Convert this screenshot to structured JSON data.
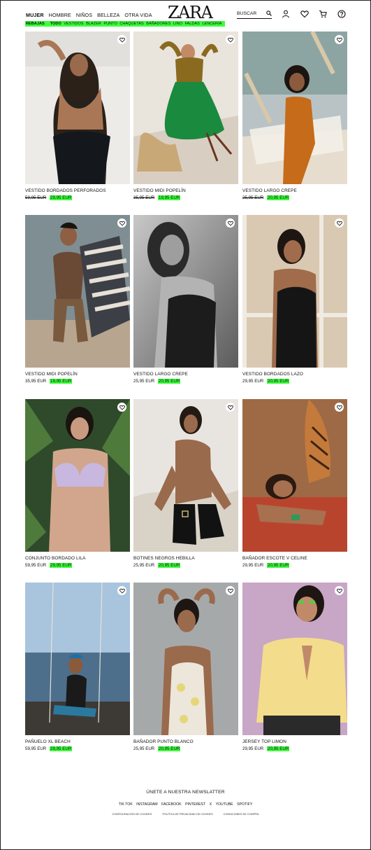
{
  "header": {
    "nav": [
      "MUJER",
      "HOMBRE",
      "NIÑOS",
      "BELLEZA",
      "OTRA VIDA"
    ],
    "active_nav": "MUJER",
    "logo": "ZARA",
    "search_placeholder": "BUSCAR",
    "icons": [
      "search-icon",
      "user-icon",
      "heart-icon",
      "cart-icon",
      "help-icon"
    ]
  },
  "categories": {
    "lead": "REBAJAS",
    "items": [
      "TODO",
      "VESTIDOS",
      "BLAZER",
      "PUNTO",
      "CHAQUETAS",
      "BAÑADORES",
      "LINO",
      "FALDAS",
      "LENCERÍA"
    ],
    "highlight_color": "#3cff3c"
  },
  "products": [
    {
      "name": "VESTIDO BORDADOS PERFORADOS",
      "old_price": "59,95 EUR",
      "sale_price": "29,95 EUR",
      "strike": true
    },
    {
      "name": "VESTIDO MIDI POPELÍN",
      "old_price": "35,95 EUR",
      "sale_price": "19,95 EUR",
      "strike": true
    },
    {
      "name": "VESTIDO LARGO CREPE",
      "old_price": "25,95 EUR",
      "sale_price": "20,95 EUR",
      "strike": true
    },
    {
      "name": "VESTIDO MIDI POPELÍN",
      "old_price": "35,95 EUR",
      "sale_price": "19,95 EUR",
      "strike": false
    },
    {
      "name": "VESTIDO LARGO CREPE",
      "old_price": "25,95 EUR",
      "sale_price": "20,95 EUR",
      "strike": false
    },
    {
      "name": "VESTIDO BORDADOS LAZO",
      "old_price": "29,95 EUR",
      "sale_price": "20,95 EUR",
      "strike": false
    },
    {
      "name": "CONJUNTO BORDADO LILA",
      "old_price": "59,95 EUR",
      "sale_price": "29,95 EUR",
      "strike": false
    },
    {
      "name": "BOTINES NEGROS HEBILLA",
      "old_price": "25,95 EUR",
      "sale_price": "20,95 EUR",
      "strike": false
    },
    {
      "name": "BAÑADOR ESCOTE V CELINE",
      "old_price": "29,95 EUR",
      "sale_price": "20,95 EUR",
      "strike": false
    },
    {
      "name": "PAÑUELO XL BEACH",
      "old_price": "59,95 EUR",
      "sale_price": "29,95 EUR",
      "strike": false
    },
    {
      "name": "BAÑADOR PUNTO BLANCO",
      "old_price": "25,95 EUR",
      "sale_price": "20,95 EUR",
      "strike": false
    },
    {
      "name": "JERSEY TOP LIMON",
      "old_price": "29,95 EUR",
      "sale_price": "20,95 EUR",
      "strike": false
    }
  ],
  "footer": {
    "newsletter": "ÚNETE A NUESTRA NEWSLATTER",
    "social": [
      "TIK TOK",
      "INSTAGRAM",
      "FACEBOOK",
      "PINTEREST",
      "X",
      "YOUTUBE",
      "SPOTIFY"
    ],
    "legal": [
      "CONFIGURACIÓN DE COOKIES",
      "POLÍTICA DE PRIVACIDAD DE COOKIES",
      "CONDICIONES DE COMPRA"
    ]
  }
}
